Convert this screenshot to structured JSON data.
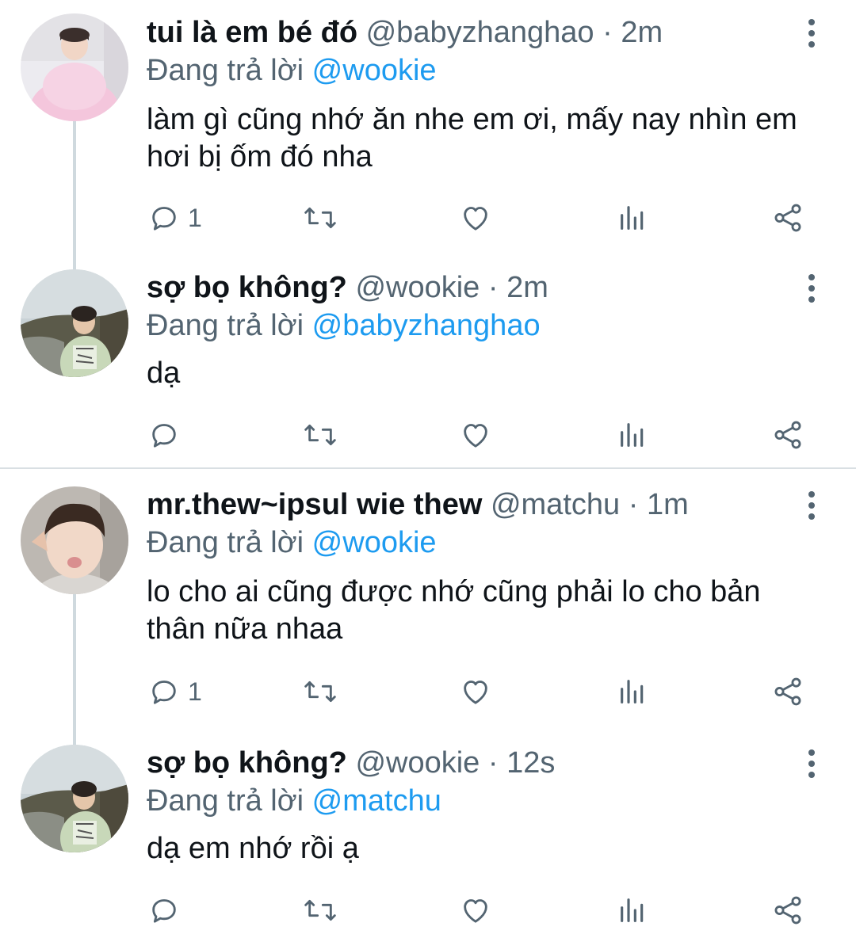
{
  "tweets": [
    {
      "name": "tui là em bé đó",
      "handle": "@babyzhanghao",
      "dot": "·",
      "time": "2m",
      "replying_label": "Đang trả lời",
      "replying_to": "@wookie",
      "text": "làm gì cũng nhớ ăn nhe em ơi, mấy nay nhìn em hơi bị ốm đó nha",
      "reply_count": "1"
    },
    {
      "name": "sợ bọ không?",
      "handle": "@wookie",
      "dot": "·",
      "time": "2m",
      "replying_label": "Đang trả lời",
      "replying_to": "@babyzhanghao",
      "text": "dạ",
      "reply_count": ""
    },
    {
      "name": "mr.thew~ipsul wie thew",
      "handle": "@matchu",
      "dot": "·",
      "time": "1m",
      "replying_label": "Đang trả lời",
      "replying_to": "@wookie",
      "text": "lo cho ai cũng được nhớ cũng phải lo cho bản thân nữa nhaa",
      "reply_count": "1"
    },
    {
      "name": "sợ bọ không?",
      "handle": "@wookie",
      "dot": "·",
      "time": "12s",
      "replying_label": "Đang trả lời",
      "replying_to": "@matchu",
      "text": "dạ em nhớ rồi ạ",
      "reply_count": ""
    }
  ],
  "icons": {
    "reply": "reply-icon",
    "retweet": "retweet-icon",
    "like": "like-icon",
    "views": "views-icon",
    "share": "share-icon",
    "more": "more-vertical-icon"
  },
  "colors": {
    "text": "#0f1419",
    "secondary": "#536471",
    "link": "#1d9bf0",
    "thread_line": "#cfd9de"
  }
}
